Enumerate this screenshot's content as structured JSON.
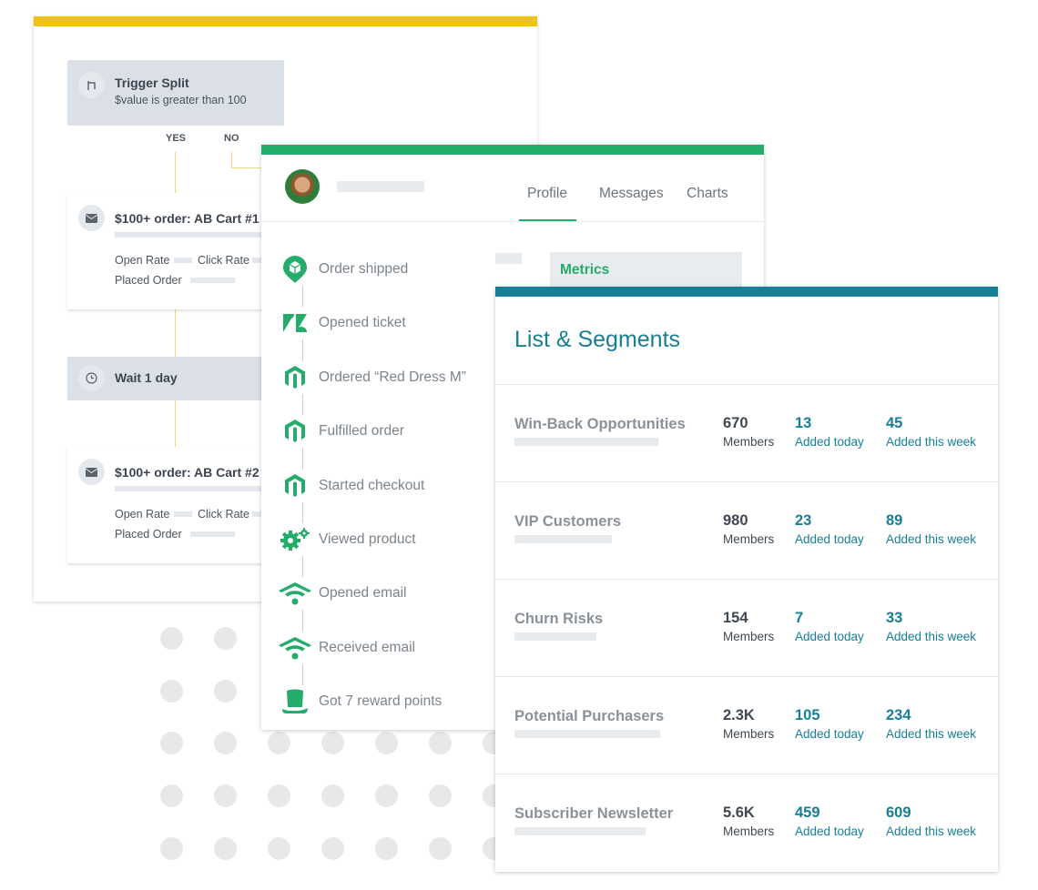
{
  "flow": {
    "accent_color": "#efc11d",
    "trigger": {
      "icon": "split-icon",
      "title": "Trigger Split",
      "condition": "$value is greater than 100"
    },
    "branches": {
      "yes": "YES",
      "no": "NO"
    },
    "emails": [
      {
        "icon": "envelope-icon",
        "title": "$100+ order: AB Cart #1",
        "open_rate": "Open Rate",
        "click_rate": "Click Rate",
        "placed_order": "Placed Order"
      },
      {
        "icon": "envelope-icon",
        "title": "$100+ order: AB Cart #2",
        "open_rate": "Open Rate",
        "click_rate": "Click Rate",
        "placed_order": "Placed Order"
      }
    ],
    "wait": {
      "icon": "clock-icon",
      "label": "Wait 1 day"
    }
  },
  "profile": {
    "accent_color": "#24ac6b",
    "tabs": [
      {
        "label": "Profile",
        "active": true
      },
      {
        "label": "Messages",
        "active": false
      },
      {
        "label": "Charts",
        "active": false
      }
    ],
    "metrics_label": "Metrics",
    "events": [
      {
        "icon": "package-pin-icon",
        "label": "Order shipped"
      },
      {
        "icon": "zendesk-icon",
        "label": "Opened ticket"
      },
      {
        "icon": "magento-icon",
        "label": "Ordered “Red Dress M”"
      },
      {
        "icon": "magento-icon",
        "label": "Fulfilled order"
      },
      {
        "icon": "magento-icon",
        "label": "Started checkout"
      },
      {
        "icon": "gears-icon",
        "label": "Viewed product"
      },
      {
        "icon": "signal-icon",
        "label": "Opened email"
      },
      {
        "icon": "signal-icon",
        "label": "Received email"
      },
      {
        "icon": "top-hat-icon",
        "label": "Got 7 reward points"
      }
    ]
  },
  "segments": {
    "accent_color": "#167f96",
    "title": "List & Segments",
    "rows": [
      {
        "name": "Win-Back Opportunities",
        "members": "670",
        "members_label": "Members",
        "today": "13",
        "today_label": "Added today",
        "week": "45",
        "week_label": "Added this week"
      },
      {
        "name": "VIP Customers",
        "members": "980",
        "members_label": "Members",
        "today": "23",
        "today_label": "Added today",
        "week": "89",
        "week_label": "Added this week"
      },
      {
        "name": "Churn Risks",
        "members": "154",
        "members_label": "Members",
        "today": "7",
        "today_label": "Added today",
        "week": "33",
        "week_label": "Added this week"
      },
      {
        "name": "Potential Purchasers",
        "members": "2.3K",
        "members_label": "Members",
        "today": "105",
        "today_label": "Added today",
        "week": "234",
        "week_label": "Added this week"
      },
      {
        "name": "Subscriber Newsletter",
        "members": "5.6K",
        "members_label": "Members",
        "today": "459",
        "today_label": "Added today",
        "week": "609",
        "week_label": "Added this week"
      }
    ]
  }
}
